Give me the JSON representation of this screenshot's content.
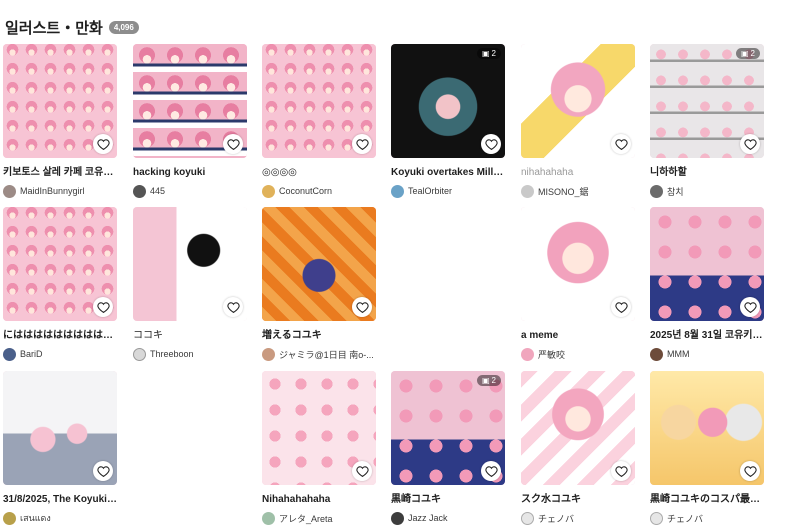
{
  "section": {
    "title": "일러스트・만화",
    "count": "4,096"
  },
  "cards": [
    {
      "title": "키보토스 살레 카페 코유키...",
      "author": "MaidInBunnygirl",
      "pages": "",
      "avatar_color": "#9c8b86"
    },
    {
      "title": "hacking koyuki",
      "author": "445",
      "pages": "",
      "avatar_color": "#555555"
    },
    {
      "title": "◎◎◎◎",
      "author": "CoconutCorn",
      "pages": "",
      "avatar_color": "#e0b25a"
    },
    {
      "title": "Koyuki overtakes Millenn...",
      "author": "TealOrbiter",
      "pages": "2",
      "avatar_color": "#6aa2c7"
    },
    {
      "title": "nihahahaha",
      "author": "MISONO_鋸",
      "pages": "",
      "avatar_color": "#c9c9c9"
    },
    {
      "title": "니하하할",
      "author": "참치",
      "pages": "2",
      "avatar_color": "#6b6b6b"
    },
    {
      "title": "にはははははははははは...",
      "author": "BariD",
      "pages": "",
      "avatar_color": "#4a5f8a"
    },
    {
      "title": "ココキ",
      "author": "Threeboon",
      "pages": "",
      "avatar_color": "#d8d8d8"
    },
    {
      "title": "増えるコユキ",
      "author": "ジャミラ@1日目 南o-...",
      "pages": "",
      "avatar_color": "#c99a80"
    },
    {
      "title": "a meme",
      "author": "严敏咬",
      "pages": "",
      "avatar_color": "#f0a6bd"
    },
    {
      "title": "2025년 8월 31일 코유키의...",
      "author": "MMM",
      "pages": "",
      "avatar_color": "#6d4b3a"
    },
    {
      "title": "31/8/2025, The Koyuki In...",
      "author": "เสนแดง",
      "pages": "",
      "avatar_color": "#b8a04a"
    },
    {
      "title": "Nihahahahaha",
      "author": "アレタ_Areta",
      "pages": "",
      "avatar_color": "#9fc0a8"
    },
    {
      "title": "黒崎コユキ",
      "author": "Jazz Jack",
      "pages": "2",
      "avatar_color": "#3d3d3d"
    },
    {
      "title": "スク水コユキ",
      "author": "チェノバ",
      "pages": "",
      "avatar_color": "#e6e6e6"
    },
    {
      "title": "黒崎コユキのコスパ最強、...",
      "author": "チェノバ",
      "pages": "",
      "avatar_color": "#e6e6e6"
    }
  ]
}
